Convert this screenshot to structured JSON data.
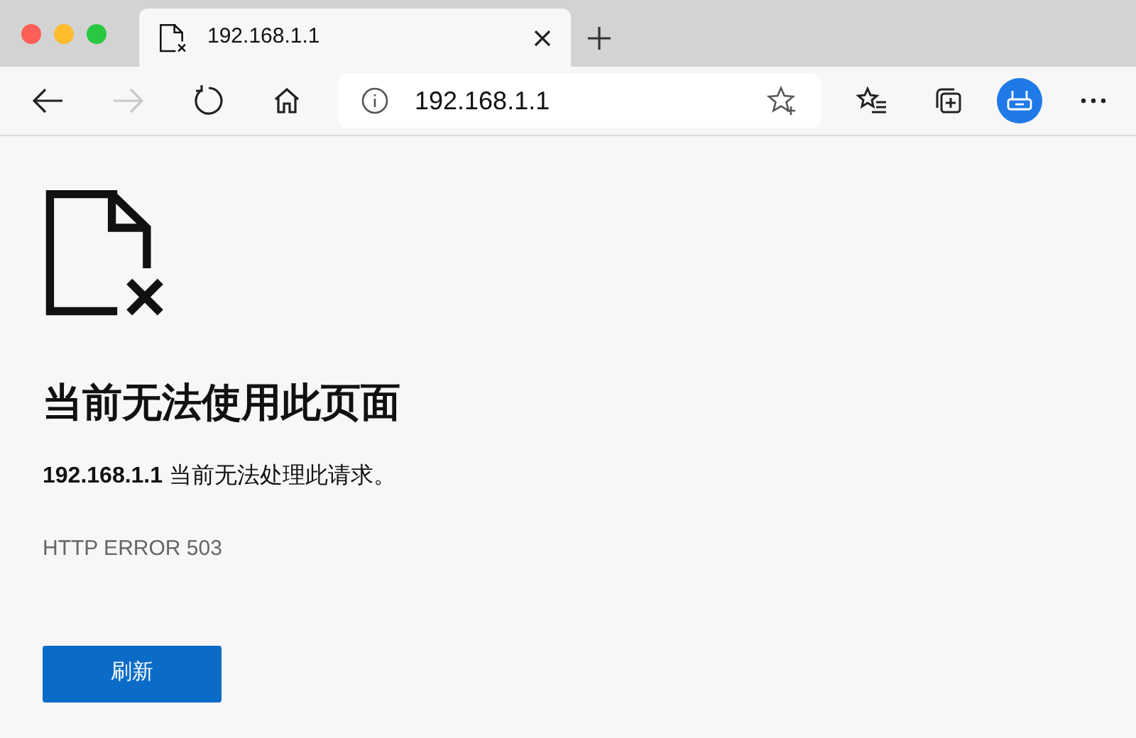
{
  "tab": {
    "title": "192.168.1.1",
    "selected": true
  },
  "address_bar": {
    "url": "192.168.1.1"
  },
  "navigation": {
    "back_disabled": false,
    "forward_disabled": true
  },
  "error_page": {
    "heading": "当前无法使用此页面",
    "message": "**192.168.1.1** 当前无法处理此请求。",
    "error_code": "HTTP ERROR 503",
    "button": "刷新"
  }
}
